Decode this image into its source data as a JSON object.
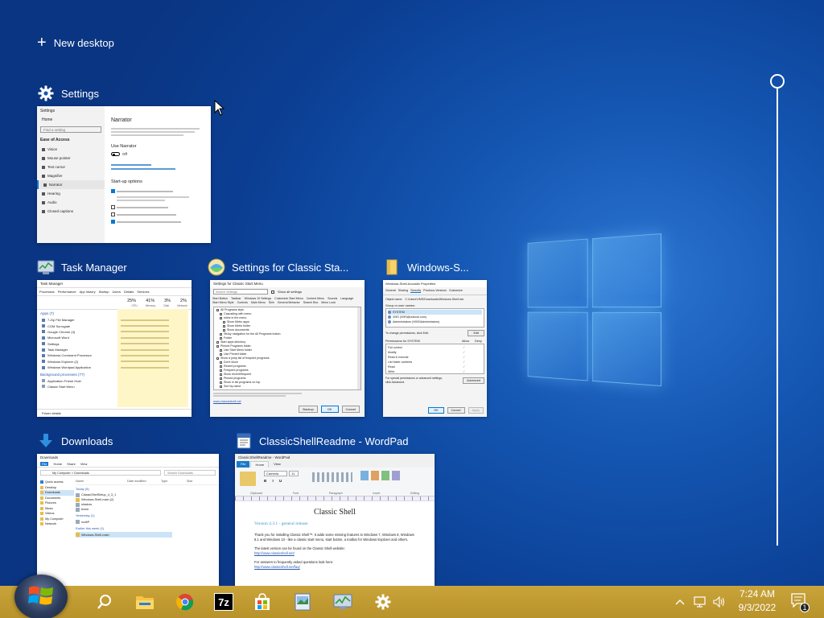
{
  "new_desktop": {
    "label": "New desktop"
  },
  "windows": {
    "settings": {
      "title": "Settings",
      "thumb": {
        "app": "Settings",
        "home": "Home",
        "search": "Find a setting",
        "section": "Ease of Access",
        "side_items": [
          "Vision",
          "Mouse pointer",
          "Text cursor",
          "Magnifier",
          "Narrator",
          "Hearing",
          "Audio",
          "Closed captions"
        ],
        "heading": "Narrator",
        "use_narrator": "Use Narrator",
        "toggle_text": "Off",
        "startup": "Start-up options"
      }
    },
    "task_manager": {
      "title": "Task Manager",
      "thumb": {
        "header": "Task Manager",
        "tabs": [
          "Processes",
          "Performance",
          "App history",
          "Startup",
          "Users",
          "Details",
          "Services"
        ],
        "stats": [
          "25%",
          "41%",
          "3%",
          "2%"
        ],
        "stat_labels": [
          "CPU",
          "Memory",
          "Disk",
          "Network"
        ],
        "group_apps": "Apps (7)",
        "apps": [
          "7-Zip File Manager",
          "COM Surrogate",
          "Google Chrome (4)",
          "Microsoft Word",
          "Settings",
          "Task Manager",
          "Windows Command Processor",
          "Windows Explorer (2)",
          "Windows Wordpad Application"
        ],
        "group_bg": "Background processes (77)",
        "bg": [
          "Application Frame Host",
          "Classic Start Menu"
        ],
        "footer": "Fewer details"
      }
    },
    "classic_shell_settings": {
      "title": "Settings for Classic Sta...",
      "thumb": {
        "header": "Settings for Classic Start Menu",
        "search": "Search Settings",
        "show_all": "Show all settings",
        "tabs": [
          "Start Button",
          "Taskbar",
          "Windows 10 Settings",
          "Customize Start Menu",
          "Context Menu",
          "Sounds",
          "Language",
          "Start Menu Style",
          "Controls",
          "Main Menu",
          "Skin",
          "General Behavior",
          "Search Box",
          "Menu Look"
        ],
        "items": [
          "All Programs style",
          "Cascading with menu",
          "Inline in the menu",
          "Show Metro apps",
          "Show Metro folder",
          "Show documents",
          "Sticky navigation for the All Programs button",
          "Folder",
          "Start apps directory",
          "Pinned Programs folder",
          "Use Start Menu folder",
          "Use Pinned folder",
          "Show a jump list of frequent programs",
          "Don't show",
          "Recent programs",
          "Frequent programs",
          "Show recent/frequent",
          "Pinned programs",
          "Show in list programs on top",
          "Sort by name"
        ],
        "backup": "Backup",
        "ok": "OK",
        "cancel": "Cancel",
        "link": "www.classicshell.net"
      }
    },
    "windows_security": {
      "title": "Windows-S...",
      "thumb": {
        "header": "Windows-Shell-Acoustic Properties",
        "tabs": [
          "General",
          "Sharing",
          "Security",
          "Previous Versions",
          "Customize"
        ],
        "object_name": "Object name:",
        "object_value": "C:\\Users\\VMS\\Downloads\\Windows-Shell.rtar",
        "group_label": "Group or user names:",
        "users": [
          "SYSTEM",
          "VMS (VMS@outlook.com)",
          "Administrators (VMS\\Administrators)"
        ],
        "change_text": "To change permissions, click Edit.",
        "edit": "Edit",
        "perm_label": "Permissions for SYSTEM",
        "allow": "Allow",
        "deny": "Deny",
        "perms": [
          "Full control",
          "Modify",
          "Read & execute",
          "List folder contents",
          "Read",
          "Write"
        ],
        "special": "For special permissions or advanced settings, click Advanced.",
        "advanced": "Advanced",
        "ok": "OK",
        "cancel": "Cancel",
        "apply": "Apply"
      }
    },
    "downloads": {
      "title": "Downloads",
      "thumb": {
        "header": "Downloads",
        "ribbon": [
          "File",
          "Home",
          "Share",
          "View"
        ],
        "path": "My Computer > Downloads",
        "search": "Search Downloads",
        "cols": [
          "Name",
          "Date modified",
          "Type",
          "Size"
        ],
        "nav": [
          "Quick access",
          "Desktop",
          "Downloads",
          "Documents",
          "Pictures",
          "Music",
          "Videos",
          "My Computer",
          "Network"
        ],
        "group_today": "Today (5)",
        "files": [
          "ClassicShellSetup_4_3_1",
          "Windows-Shell-main (2)",
          "shadow",
          "boxer"
        ],
        "group_yesterday": "Yesterday (1)",
        "file_y": "rooftP",
        "group_earlier": "Earlier this week (1)",
        "file_e": "Windows-Shell-main"
      }
    },
    "wordpad": {
      "title": "ClassicShellReadme - WordPad",
      "thumb": {
        "header": "ClassicShellReadme - WordPad",
        "ribbon": [
          "File",
          "Home",
          "View"
        ],
        "font": "Cambria",
        "size": "11",
        "groups": [
          "Clipboard",
          "Font",
          "Paragraph",
          "Insert",
          "Editing"
        ],
        "doc_title": "Classic Shell",
        "doc_subtitle": "Version 4.3.1 - general release",
        "p1": "Thank you for installing Classic Shell™. It adds some missing features to Windows 7, Windows 8, Windows 8.1 and Windows 10 - like a classic start menu, start button, a toolbar for Windows Explorer and others.",
        "p2": "The latest version can be found on the Classic Shell website:",
        "link1": "http://www.classicshell.net/",
        "p3": "For answers to frequently asked questions look here:",
        "link2": "http://www.classicshell.net/faq/"
      }
    }
  },
  "taskbar": {
    "pinned": [
      "search-icon",
      "file-explorer-icon",
      "chrome-icon",
      "7zip-icon",
      "microsoft-store-icon",
      "picture-icon",
      "task-manager-icon",
      "settings-icon"
    ],
    "sevenzip_label": "7z",
    "clock_time": "7:24 AM",
    "clock_date": "9/3/2022",
    "notification_count": "1"
  },
  "colors": {
    "taskbar": "#c1a033",
    "desktop_blue": "#1456b2",
    "accent_blue": "#0078d7"
  }
}
